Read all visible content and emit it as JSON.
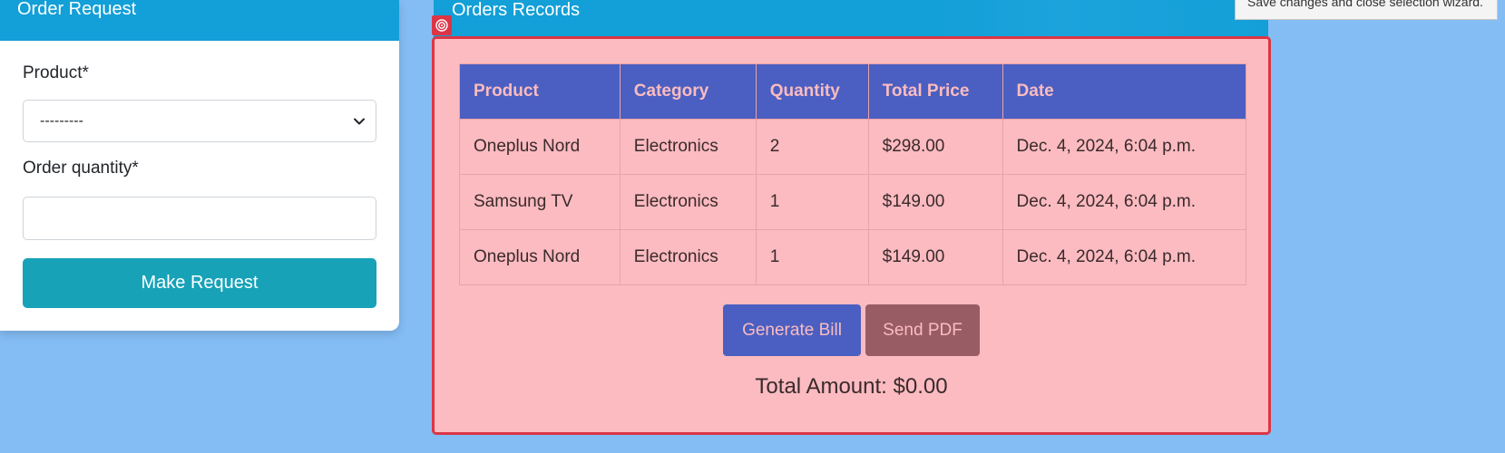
{
  "order_request": {
    "title": "Order Request",
    "product_label": "Product*",
    "product_selected": "---------",
    "quantity_label": "Order quantity*",
    "quantity_value": "",
    "submit_label": "Make Request"
  },
  "orders_records": {
    "title": "Orders Records",
    "columns": [
      "Product",
      "Category",
      "Quantity",
      "Total Price",
      "Date"
    ],
    "rows": [
      [
        "Oneplus Nord",
        "Electronics",
        "2",
        "$298.00",
        "Dec. 4, 2024, 6:04 p.m."
      ],
      [
        "Samsung TV",
        "Electronics",
        "1",
        "$149.00",
        "Dec. 4, 2024, 6:04 p.m."
      ],
      [
        "Oneplus Nord",
        "Electronics",
        "1",
        "$149.00",
        "Dec. 4, 2024, 6:04 p.m."
      ]
    ],
    "generate_bill_label": "Generate Bill",
    "send_pdf_label": "Send PDF",
    "total_amount": "Total Amount: $0.00"
  },
  "tooltip": {
    "text": "Save changes and close selection wizard."
  },
  "colors": {
    "background": "#84bdf4",
    "header_blue": "#139fd7",
    "panel_pink": "#fbbbc0",
    "panel_border": "#dc3545",
    "table_header": "#4a5fc1",
    "button_teal": "#17a2b8",
    "button_mauve": "#985c65"
  },
  "icons": {
    "select_arrow": "chevron-down-icon",
    "selection_target": "target-icon"
  }
}
